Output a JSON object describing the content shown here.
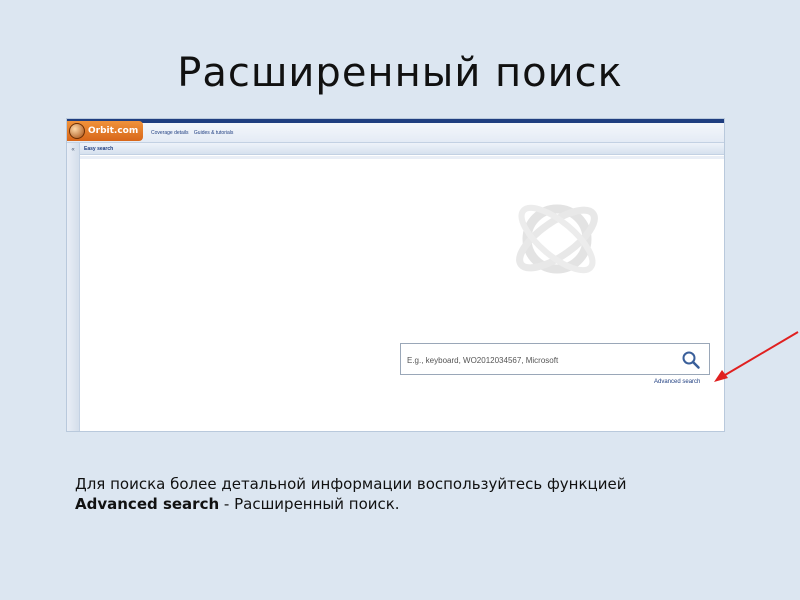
{
  "slide": {
    "title": "Расширенный поиск",
    "caption_text": "Для поиска более детальной информации воспользуйтесь функцией",
    "caption_bold": "Advanced search",
    "caption_rest": " - Расширенный поиск."
  },
  "app": {
    "logo_text": "Orbit.com",
    "top_links": [
      "Coverage details",
      "Guides & tutorials"
    ],
    "left_toggle": "«",
    "section_label": "Easy search",
    "search": {
      "value": "",
      "placeholder": "E.g., keyboard, WO2012034567, Microsoft"
    },
    "advanced_link": "Advanced search"
  },
  "colors": {
    "brand_orange": "#e27a25",
    "brand_navy": "#1f3e80",
    "arrow_red": "#e02020"
  },
  "icons": [
    "orbit-logo-icon",
    "orbit-watermark-icon",
    "search-icon",
    "collapse-icon",
    "red-arrow-icon"
  ]
}
